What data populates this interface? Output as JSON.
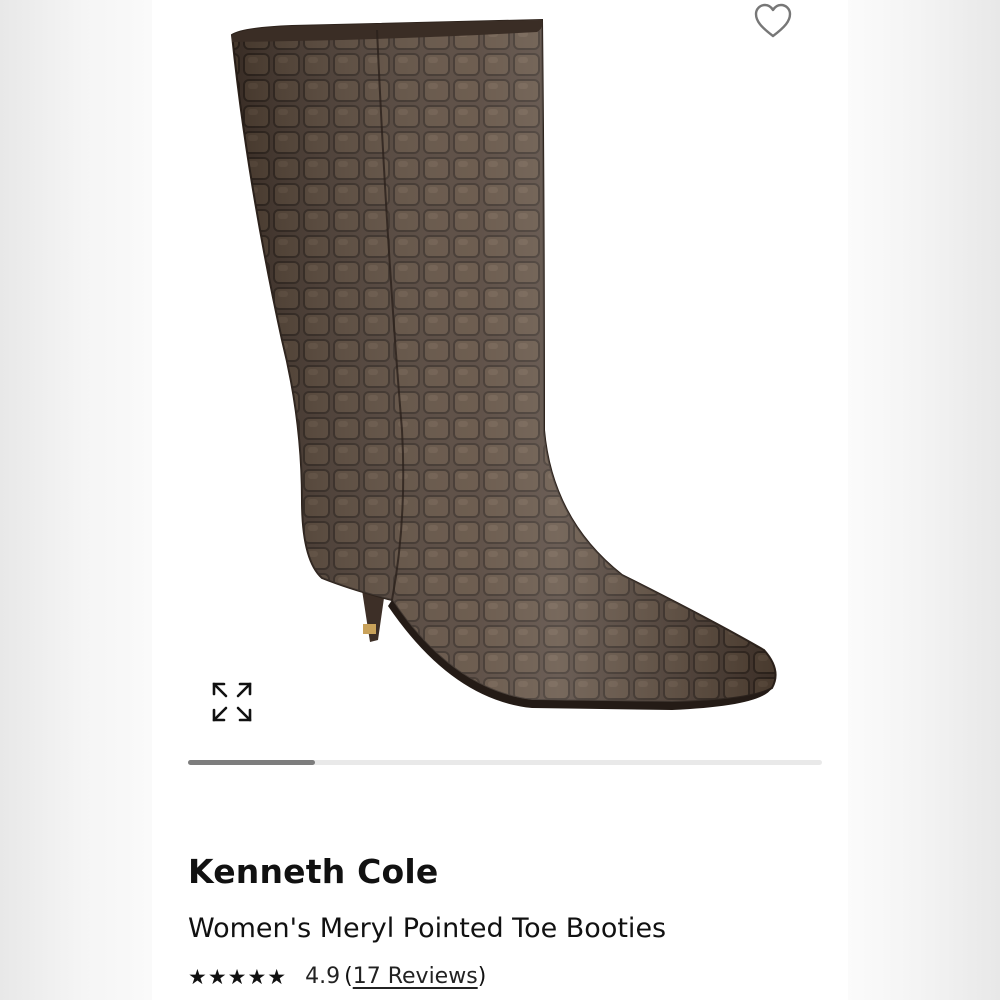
{
  "product": {
    "brand": "Kenneth Cole",
    "name": "Women's Meryl Pointed Toe Booties",
    "image_icon": "croc-boot-image"
  },
  "rating": {
    "stars_text": "★★★★★",
    "value": "4.9",
    "reviews_open": "(",
    "reviews_link": "17 Reviews",
    "reviews_close": ")"
  },
  "carousel": {
    "progress": 0.2
  },
  "icons": {
    "favorite": "heart-icon",
    "expand": "expand-icon"
  },
  "colors": {
    "boot": "#4a3a30",
    "track": "#e9e9e9",
    "thumb": "#7d7d7d"
  }
}
